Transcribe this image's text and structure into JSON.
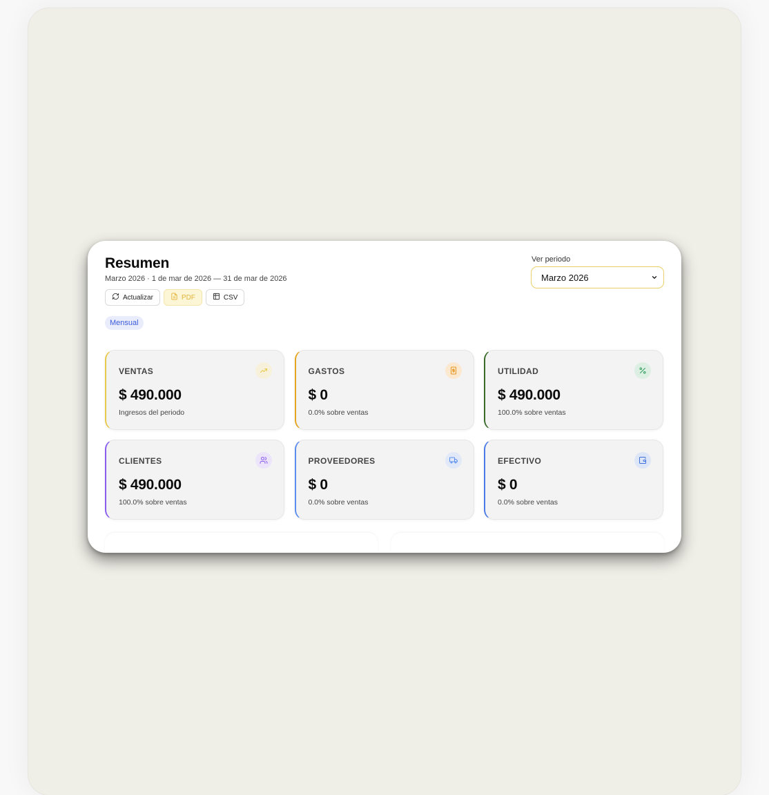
{
  "header": {
    "title": "Resumen",
    "subtitle": "Marzo 2026 · 1 de mar de 2026 — 31 de mar de 2026"
  },
  "actions": {
    "refresh_label": "Actualizar",
    "pdf_label": "PDF",
    "csv_label": "CSV"
  },
  "badge": "Mensual",
  "period": {
    "label": "Ver periodo",
    "selected": "Marzo 2026"
  },
  "cards": [
    {
      "label": "VENTAS",
      "value": "$ 490.000",
      "note": "Ingresos del periodo",
      "icon": "trending-up-icon",
      "accent": "#e9c94a",
      "icon_color": "#e9c94a",
      "icon_bg": "#f7f1dc"
    },
    {
      "label": "GASTOS",
      "value": "$ 0",
      "note": "0.0% sobre ventas",
      "icon": "receipt-icon",
      "accent": "#e6a51e",
      "icon_color": "#e6951e",
      "icon_bg": "#fbe8cf"
    },
    {
      "label": "UTILIDAD",
      "value": "$ 490.000",
      "note": "100.0% sobre ventas",
      "icon": "percent-icon",
      "accent": "#3a6b2a",
      "icon_color": "#2f9e5c",
      "icon_bg": "#dcefe2"
    },
    {
      "label": "CLIENTES",
      "value": "$ 490.000",
      "note": "100.0% sobre ventas",
      "icon": "users-icon",
      "accent": "#8a5cf0",
      "icon_color": "#8a5cf0",
      "icon_bg": "#ece4fb"
    },
    {
      "label": "PROVEEDORES",
      "value": "$ 0",
      "note": "0.0% sobre ventas",
      "icon": "truck-icon",
      "accent": "#5b8def",
      "icon_color": "#5b8def",
      "icon_bg": "#e1e9f8"
    },
    {
      "label": "EFECTIVO",
      "value": "$ 0",
      "note": "0.0% sobre ventas",
      "icon": "wallet-icon",
      "accent": "#4a7be8",
      "icon_color": "#3f6fe0",
      "icon_bg": "#dde6f7"
    }
  ]
}
